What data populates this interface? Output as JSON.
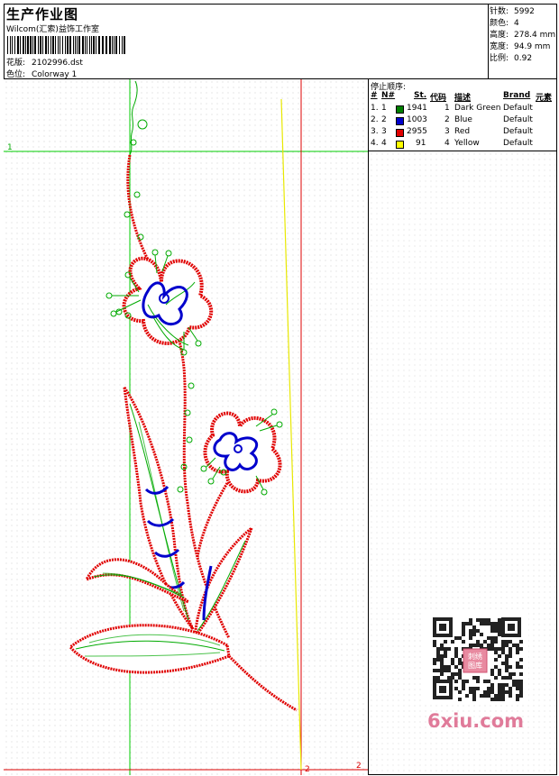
{
  "header": {
    "title": "生产作业图",
    "studio": "Wilcom(汇索)益饰工作室",
    "design_label": "花版:",
    "design_value": "2102996.dst",
    "colorway_label": "色位:",
    "colorway_value": "Colorway 1"
  },
  "stats": [
    {
      "label": "针数:",
      "value": "5992"
    },
    {
      "label": "颜色:",
      "value": "4"
    },
    {
      "label": "高度:",
      "value": "278.4 mm"
    },
    {
      "label": "宽度:",
      "value": "94.9 mm"
    },
    {
      "label": "比例:",
      "value": "0.92"
    }
  ],
  "stop_sequence": {
    "title": "停止顺序:",
    "columns": {
      "num": "#",
      "needle": "N#",
      "stitches": "St.",
      "code": "代码",
      "desc": "描述",
      "brand": "Brand",
      "element": "元素"
    },
    "rows": [
      {
        "num": "1.",
        "needle": "1",
        "color": "#008000",
        "stitches": "1941",
        "code": "1",
        "desc": "Dark Green",
        "brand": "Default"
      },
      {
        "num": "2.",
        "needle": "2",
        "color": "#0000cc",
        "stitches": "1003",
        "code": "2",
        "desc": "Blue",
        "brand": "Default"
      },
      {
        "num": "3.",
        "needle": "3",
        "color": "#e00000",
        "stitches": "2955",
        "code": "3",
        "desc": "Red",
        "brand": "Default"
      },
      {
        "num": "4.",
        "needle": "4",
        "color": "#ffff00",
        "stitches": "91",
        "code": "4",
        "desc": "Yellow",
        "brand": "Default"
      }
    ]
  },
  "canvas": {
    "marker_1": "1",
    "marker_2a": "2",
    "marker_2b": "2",
    "guide_green": "#00cc00",
    "guide_red": "#dd0000",
    "guide_yellow": "#e8e800"
  },
  "watermark": {
    "brand": "6xiu.com",
    "qr_icon": "qr-code-icon",
    "seal_text": "刺绣 图库"
  }
}
